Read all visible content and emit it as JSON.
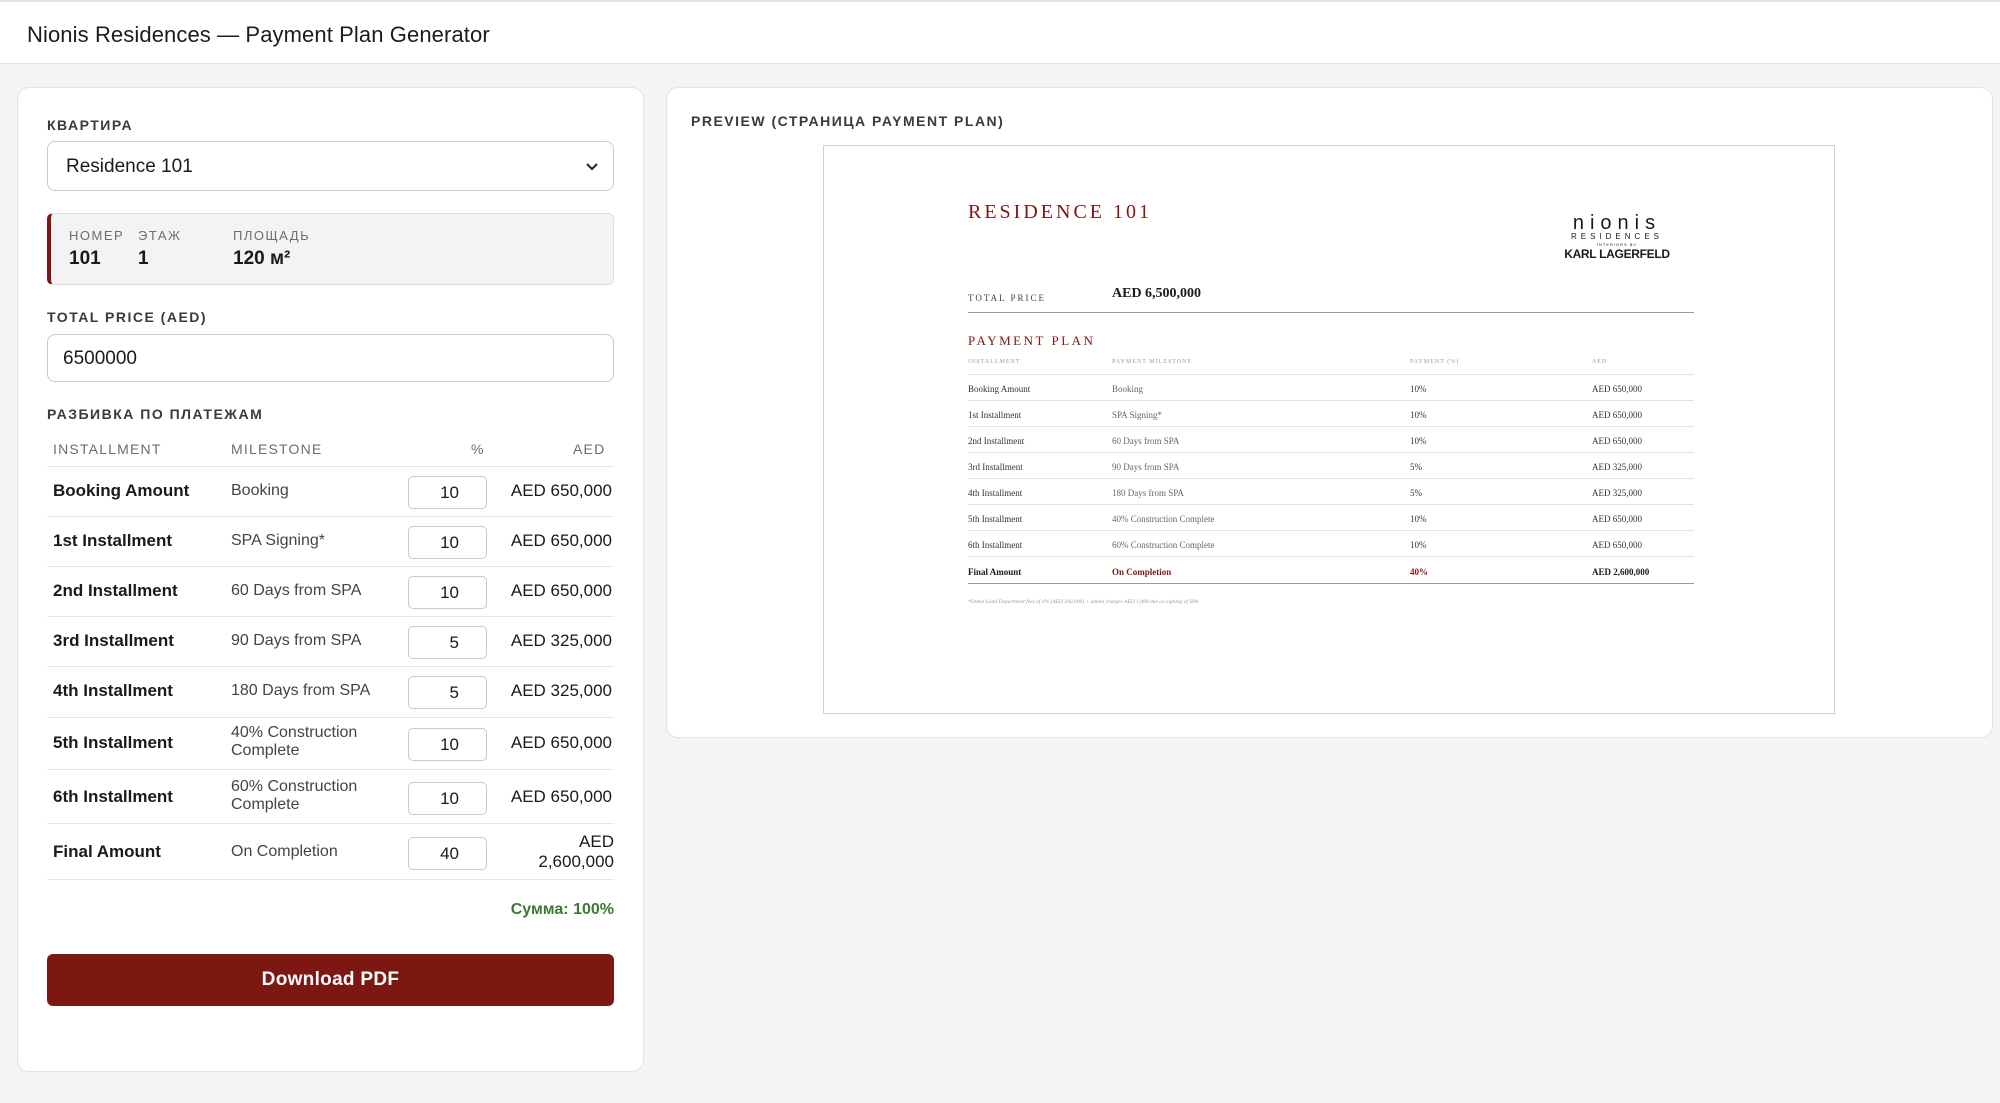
{
  "app": {
    "title": "Nionis Residences — Payment Plan Generator"
  },
  "form": {
    "apartment_label": "КВАРТИРА",
    "apartment_selected": "Residence 101",
    "info": [
      {
        "label": "НОМЕР",
        "value": "101"
      },
      {
        "label": "ЭТАЖ",
        "value": "1"
      },
      {
        "label": "ПЛОЩАДЬ",
        "value": "120 м²"
      }
    ],
    "total_price_label": "TOTAL PRICE (AED)",
    "total_price_value": "6500000",
    "breakdown_label": "РАЗБИВКА ПО ПЛАТЕЖАМ",
    "columns": {
      "installment": "INSTALLMENT",
      "milestone": "MILESTONE",
      "pct": "%",
      "aed": "AED"
    },
    "rows": [
      {
        "installment": "Booking Amount",
        "milestone": "Booking",
        "pct": "10",
        "aed": "AED 650,000"
      },
      {
        "installment": "1st Installment",
        "milestone": "SPA Signing*",
        "pct": "10",
        "aed": "AED 650,000"
      },
      {
        "installment": "2nd Installment",
        "milestone": "60 Days from SPA",
        "pct": "10",
        "aed": "AED 650,000"
      },
      {
        "installment": "3rd Installment",
        "milestone": "90 Days from SPA",
        "pct": "5",
        "aed": "AED 325,000"
      },
      {
        "installment": "4th Installment",
        "milestone": "180 Days from SPA",
        "pct": "5",
        "aed": "AED 325,000"
      },
      {
        "installment": "5th Installment",
        "milestone": "40% Construction Complete",
        "pct": "10",
        "aed": "AED 650,000"
      },
      {
        "installment": "6th Installment",
        "milestone": "60% Construction Complete",
        "pct": "10",
        "aed": "AED 650,000"
      },
      {
        "installment": "Final Amount",
        "milestone": "On Completion",
        "pct": "40",
        "aed": "AED 2,600,000"
      }
    ],
    "sum_text": "Сумма: 100%",
    "download_label": "Download PDF",
    "accent_color": "#7d1712",
    "sum_color": "#3a7a30"
  },
  "preview": {
    "label": "PREVIEW (СТРАНИЦА PAYMENT PLAN)",
    "title": "RESIDENCE 101",
    "logo": {
      "line1": "nionis",
      "line2": "RESIDENCES",
      "line3": "INTERIORS BY",
      "line4": "KARL LAGERFELD"
    },
    "total_price_label": "TOTAL PRICE",
    "total_price_value": "AED 6,500,000",
    "plan_title": "PAYMENT PLAN",
    "columns": {
      "installment": "INSTALLMENT",
      "milestone": "PAYMENT MILESTONE",
      "pct": "PAYMENT (%)",
      "aed": "AED"
    },
    "rows": [
      {
        "installment": "Booking Amount",
        "milestone": "Booking",
        "pct": "10%",
        "aed": "AED 650,000"
      },
      {
        "installment": "1st Installment",
        "milestone": "SPA Signing*",
        "pct": "10%",
        "aed": "AED 650,000"
      },
      {
        "installment": "2nd Installment",
        "milestone": "60 Days from SPA",
        "pct": "10%",
        "aed": "AED 650,000"
      },
      {
        "installment": "3rd Installment",
        "milestone": "90 Days from SPA",
        "pct": "5%",
        "aed": "AED 325,000"
      },
      {
        "installment": "4th Installment",
        "milestone": "180 Days from SPA",
        "pct": "5%",
        "aed": "AED 325,000"
      },
      {
        "installment": "5th Installment",
        "milestone": "40% Construction Complete",
        "pct": "10%",
        "aed": "AED 650,000"
      },
      {
        "installment": "6th Installment",
        "milestone": "60% Construction Complete",
        "pct": "10%",
        "aed": "AED 650,000"
      },
      {
        "installment": "Final Amount",
        "milestone": "On Completion",
        "pct": "40%",
        "aed": "AED 2,600,000"
      }
    ],
    "footnote": "*Dubai Land Department fees of 4% (AED 260,000) + admin charges AED 1,000 due on signing of SPA"
  }
}
